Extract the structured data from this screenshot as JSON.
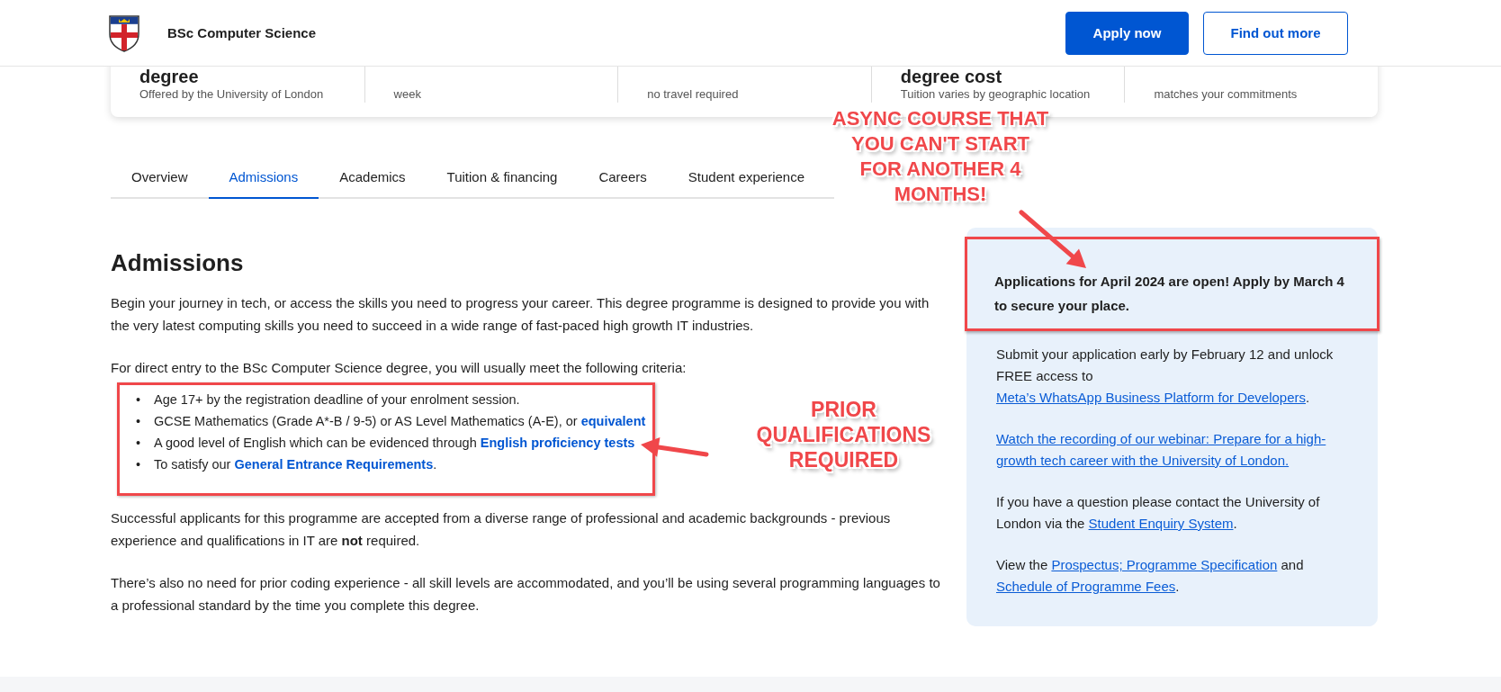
{
  "header": {
    "title": "BSc Computer Science",
    "buttons": [
      {
        "label": "Apply now",
        "kind": "primary"
      },
      {
        "label": "Find out more",
        "kind": "secondary"
      }
    ]
  },
  "stats": [
    {
      "title": "degree",
      "subtitle": "Offered by the University of London"
    },
    {
      "subtitle": "week"
    },
    {
      "subtitle": "no travel required"
    },
    {
      "title": "degree cost",
      "subtitle": "Tuition varies by geographic location"
    },
    {
      "subtitle": "matches your commitments"
    }
  ],
  "tabs": [
    {
      "label": "Overview",
      "selected": false
    },
    {
      "label": "Admissions",
      "selected": true
    },
    {
      "label": "Academics",
      "selected": false
    },
    {
      "label": "Tuition & financing",
      "selected": false
    },
    {
      "label": "Careers",
      "selected": false
    },
    {
      "label": "Student experience",
      "selected": false
    }
  ],
  "admissions": {
    "heading": "Admissions",
    "intro": "Begin your journey in tech, or access the skills you need to progress your career. This degree programme is designed to provide you with the very latest computing skills you need to succeed in a wide range of fast-paced high growth IT industries.",
    "criteria_intro": "For direct entry to the BSc Computer Science degree, you will usually meet the following criteria:",
    "criteria": [
      {
        "marker": "•",
        "segments": [
          {
            "text": "Age 17+ by the registration deadline of your enrolment session."
          }
        ]
      },
      {
        "marker": "•",
        "segments": [
          {
            "text": "GCSE Mathematics (Grade A*-B / 9-5) or AS Level Mathematics (A-E), or "
          },
          {
            "text": "equivalent",
            "kind": "link"
          }
        ]
      },
      {
        "marker": "•",
        "segments": [
          {
            "text": "A good level of English which can be evidenced through "
          },
          {
            "text": "English proficiency tests",
            "kind": "link"
          }
        ]
      },
      {
        "marker": "•",
        "segments": [
          {
            "text": "To satisfy our "
          },
          {
            "text": "General Entrance Requirements",
            "kind": "link"
          },
          {
            "text": "."
          }
        ]
      }
    ],
    "paragraphs": [
      "Successful applicants for this programme are accepted from a diverse range of professional and academic backgrounds - previous experience and qualifications in IT are **not** required.",
      "There’s also no need for prior coding experience - all skill levels are accommodated, and you’ll be using several programming languages to a professional standard by the time you complete this degree."
    ]
  },
  "sidebar": {
    "highlight": "Applications for April 2024 are open! Apply by March 4 to secure your place.",
    "paragraphs": [
      [
        {
          "text": "Submit your application early by February 12 and unlock FREE access to "
        },
        {
          "text": "Meta’s WhatsApp Business Platform for Developers",
          "kind": "link"
        },
        {
          "text": "."
        }
      ],
      [
        {
          "text": "Watch the recording of our webinar: Prepare for a high-growth tech career with the University of London.",
          "kind": "link"
        }
      ],
      [
        {
          "text": "If you have a question please contact the University of London via the "
        },
        {
          "text": "Student Enquiry System",
          "kind": "link"
        },
        {
          "text": "."
        }
      ],
      [
        {
          "text": "View the "
        },
        {
          "text": "Prospectus; Programme Specification",
          "kind": "link"
        },
        {
          "text": " and "
        },
        {
          "text": "Schedule of Programme Fees",
          "kind": "link"
        },
        {
          "text": "."
        }
      ]
    ]
  },
  "annotations": [
    {
      "lines": [
        "ASYNC COURSE THAT",
        "YOU CAN'T START",
        "FOR ANOTHER 4",
        "MONTHS!"
      ]
    },
    {
      "lines": [
        "PRIOR",
        "QUALIFICATIONS",
        "REQUIRED"
      ]
    }
  ]
}
